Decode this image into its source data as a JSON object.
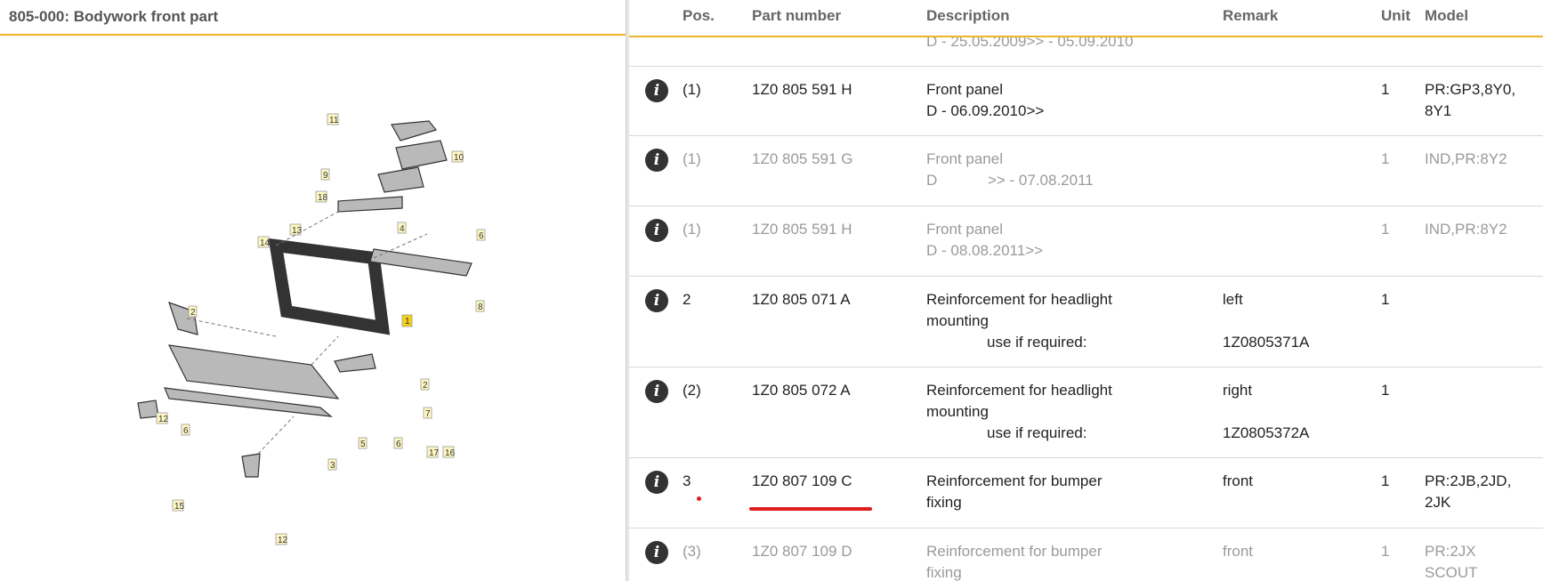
{
  "left_panel": {
    "title": "805-000: Bodywork front part"
  },
  "diagram": {
    "callouts": [
      "11",
      "10",
      "9",
      "18",
      "13",
      "14",
      "4",
      "6",
      "8",
      "1",
      "2",
      "2",
      "7",
      "12",
      "6",
      "5",
      "6",
      "17",
      "16",
      "3",
      "15",
      "12"
    ]
  },
  "table": {
    "headers": {
      "pos": "Pos.",
      "part": "Part number",
      "desc": "Description",
      "remark": "Remark",
      "unit": "Unit",
      "model": "Model"
    },
    "partial_row": {
      "desc": "D - 25.05.2009>> - 05.09.2010"
    },
    "rows": [
      {
        "pos": "(1)",
        "part": "1Z0 805 591 H",
        "desc": "Front panel",
        "desc2": "D - 06.09.2010>>",
        "remark": "",
        "remark2": "",
        "unit": "1",
        "model": "PR:GP3,8Y0,",
        "model2": "8Y1",
        "muted": false
      },
      {
        "pos": "(1)",
        "part": "1Z0 805 591 G",
        "desc": "Front panel",
        "desc2": "D            >> - 07.08.2011",
        "remark": "",
        "remark2": "",
        "unit": "1",
        "model": "IND,PR:8Y2",
        "model2": "",
        "muted": true
      },
      {
        "pos": "(1)",
        "part": "1Z0 805 591 H",
        "desc": "Front panel",
        "desc2": "D - 08.08.2011>>",
        "remark": "",
        "remark2": "",
        "unit": "1",
        "model": "IND,PR:8Y2",
        "model2": "",
        "muted": true
      },
      {
        "pos": "2",
        "part": "1Z0 805 071 A",
        "desc": "Reinforcement for headlight",
        "desc2": "mounting",
        "desc3": "use if required:",
        "remark": "left",
        "remark2": "1Z0805371A",
        "unit": "1",
        "model": "",
        "model2": "",
        "muted": false
      },
      {
        "pos": "(2)",
        "part": "1Z0 805 072 A",
        "desc": "Reinforcement for headlight",
        "desc2": "mounting",
        "desc3": "use if required:",
        "remark": "right",
        "remark2": "1Z0805372A",
        "unit": "1",
        "model": "",
        "model2": "",
        "muted": false
      },
      {
        "pos": "3",
        "part": "1Z0 807 109 C",
        "desc": "Reinforcement for bumper",
        "desc2": "fixing",
        "remark": "front",
        "remark2": "",
        "unit": "1",
        "model": "PR:2JB,2JD,",
        "model2": "2JK",
        "muted": false
      },
      {
        "pos": "(3)",
        "part": "1Z0 807 109 D",
        "desc": "Reinforcement for bumper",
        "desc2": "fixing",
        "remark": "front",
        "remark2": "",
        "unit": "1",
        "model": "PR:2JX",
        "model2": "SCOUT",
        "muted": true
      }
    ],
    "info_icon": "i"
  },
  "colors": {
    "accent": "#f0b429",
    "annotation": "#e01d1d"
  }
}
